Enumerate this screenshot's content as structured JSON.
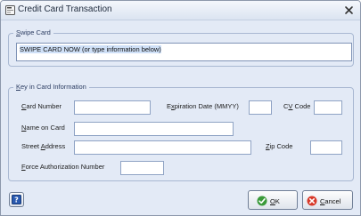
{
  "window": {
    "title": "Credit Card Transaction"
  },
  "swipe": {
    "legend_first": "S",
    "legend_rest": "wipe Card",
    "value": "SWIPE CARD NOW (or type information below)"
  },
  "card_info": {
    "legend_first": "K",
    "legend_rest": "ey in Card Information",
    "card_number": {
      "mn": "C",
      "rest": "ard Number",
      "value": ""
    },
    "expiration": {
      "pre": "E",
      "mn": "x",
      "post": "piration Date (MMYY)",
      "value": ""
    },
    "cv_code": {
      "pre": "C",
      "mn": "V",
      "post": " Code",
      "value": ""
    },
    "name_on_card": {
      "mn": "N",
      "rest": "ame on Card",
      "value": ""
    },
    "street_address": {
      "pre": "Street ",
      "mn": "A",
      "post": "ddress",
      "value": ""
    },
    "zip_code": {
      "mn": "Z",
      "rest": "ip Code",
      "value": ""
    },
    "force_auth": {
      "mn": "F",
      "rest": "orce Authorization Number",
      "value": ""
    }
  },
  "buttons": {
    "ok_mn": "O",
    "ok_rest": "K",
    "cancel_mn": "C",
    "cancel_rest": "ancel"
  },
  "icons": {
    "app": "card-terminal-icon",
    "close": "close-icon",
    "help": "help-icon",
    "ok": "check-circle-icon",
    "cancel": "cancel-circle-icon"
  },
  "colors": {
    "ok_green": "#3a9a3a",
    "cancel_red": "#d83a2a",
    "help_blue": "#2a5ab0"
  }
}
